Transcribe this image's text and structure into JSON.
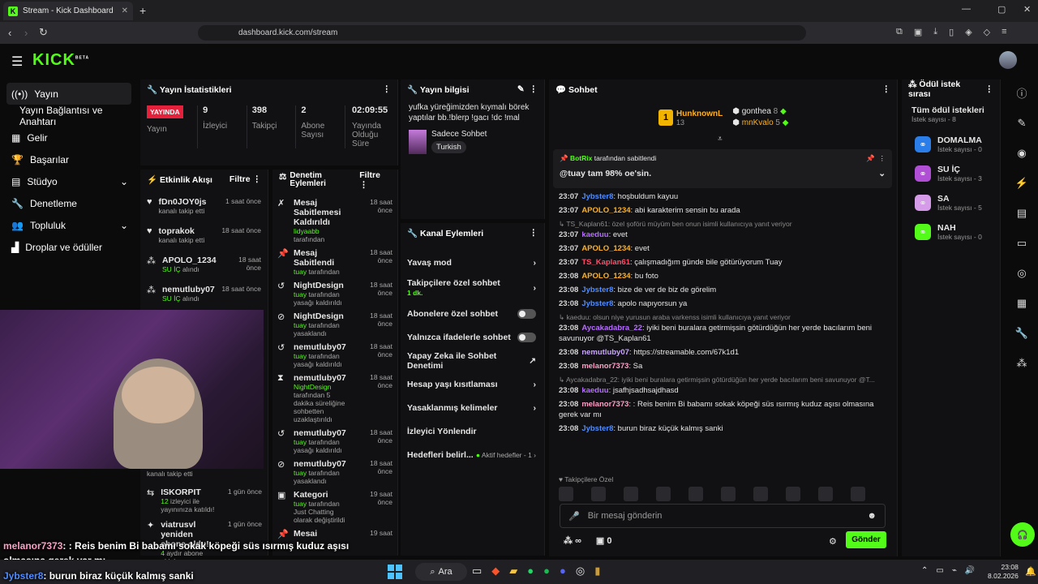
{
  "browser": {
    "tab_title": "Stream - Kick Dashboard",
    "url": "dashboard.kick.com/stream"
  },
  "brand": {
    "logo": "KICK",
    "beta": "BETA",
    "accent": "#53fc18"
  },
  "sidebar": {
    "items": [
      {
        "label": "Yayın",
        "icon": "broadcast-icon"
      },
      {
        "label": "Yayın Bağlantısı ve Anahtarı",
        "icon": ""
      },
      {
        "label": "Gelir",
        "icon": "revenue-icon"
      },
      {
        "label": "Başarılar",
        "icon": "trophy-icon"
      },
      {
        "label": "Stüdyo",
        "icon": "studio-icon"
      },
      {
        "label": "Denetleme",
        "icon": "wrench-icon"
      },
      {
        "label": "Topluluk",
        "icon": "community-icon"
      },
      {
        "label": "Droplar ve ödüller",
        "icon": "drops-icon"
      }
    ]
  },
  "stats": {
    "title": "Yayın İstatistikleri",
    "live_badge": "YAYINDA",
    "live_label": "Yayın",
    "viewers": "9",
    "viewers_label": "İzleyici",
    "followers": "398",
    "followers_label": "Takipçi",
    "subs": "2",
    "subs_label": "Abone Sayısı",
    "uptime": "02:09:55",
    "uptime_label": "Yayında Olduğu Süre"
  },
  "streaminfo": {
    "title": "Yayın bilgisi",
    "stream_title": "yufka yüreğimizden kıymalı börek yaptılar bb.!blerp !gacı !dc !mal",
    "category": "Sadece Sohbet",
    "language": "Turkish"
  },
  "activity": {
    "title": "Etkinlik Akışı",
    "filter": "Filtre",
    "items": [
      {
        "name": "fDn0JOY0js",
        "sub": "kanalı takip etti",
        "when": "1 saat önce"
      },
      {
        "name": "toprakok",
        "sub": "kanalı takip etti",
        "when": "18 saat önce"
      },
      {
        "name": "APOLO_1234",
        "sub_hl": "SU İÇ",
        "sub": " alındı",
        "when": "18 saat önce"
      },
      {
        "name": "nemutluby07",
        "sub_hl": "SU İÇ",
        "sub": " alındı",
        "when": "18 saat önce"
      }
    ],
    "lower": [
      {
        "name": "",
        "sub": "kanalı takip etti",
        "when": ""
      },
      {
        "name": "ISKORPIT",
        "sub_hl": "12",
        "sub": " izleyici ile yayınınıza katıldı!",
        "when": "1 gün önce"
      },
      {
        "name": "viatrusvl yeniden abone oldu!",
        "sub_hl": "4",
        "sub": " aydır abone oldular",
        "when": "1 gün önce"
      }
    ]
  },
  "modlog": {
    "title": "Denetim Eylemleri",
    "filter": "Filtre",
    "items": [
      {
        "name": "Mesaj Sabitlemesi Kaldırıldı",
        "by": "lidyaabb",
        "sub": " tarafından",
        "when": "18 saat önce"
      },
      {
        "name": "Mesaj Sabitlendi",
        "by": "tuay",
        "sub": " tarafından",
        "when": "18 saat önce"
      },
      {
        "name": "NightDesign",
        "by": "tuay",
        "sub": " tarafından yasağı kaldırıldı",
        "when": "18 saat önce"
      },
      {
        "name": "NightDesign",
        "by": "tuay",
        "sub": " tarafından yasaklandı",
        "when": "18 saat önce"
      },
      {
        "name": "nemutluby07",
        "by": "tuay",
        "sub": " tarafından yasağı kaldırıldı",
        "when": "18 saat önce"
      },
      {
        "name": "nemutluby07",
        "by": "NightDesign",
        "sub": " tarafından 5 dakika süreliğine sohbetten uzaklaştırıldı",
        "when": "18 saat önce"
      },
      {
        "name": "nemutluby07",
        "by": "tuay",
        "sub": " tarafından yasağı kaldırıldı",
        "when": "18 saat önce"
      },
      {
        "name": "nemutluby07",
        "by": "tuay",
        "sub": " tarafından yasaklandı",
        "when": "18 saat önce"
      },
      {
        "name": "Kategori",
        "by": "tuay",
        "sub": " tarafından Just Chatting olarak değiştirildi",
        "when": "19 saat önce"
      },
      {
        "name": "Mesai",
        "by": "",
        "sub": "",
        "when": "19 saat"
      }
    ]
  },
  "channel_actions": {
    "title": "Kanal Eylemleri",
    "items": [
      {
        "label": "Yavaş mod",
        "kind": "chevron"
      },
      {
        "label": "Takipçilere özel sohbet",
        "extra": "1 dk.",
        "kind": "chevron"
      },
      {
        "label": "Abonelere özel sohbet",
        "kind": "toggle"
      },
      {
        "label": "Yalnızca ifadelerle sohbet",
        "kind": "toggle"
      },
      {
        "label": "Yapay Zeka ile Sohbet Denetimi",
        "kind": "external"
      },
      {
        "label": "Hesap yaşı kısıtlaması",
        "kind": "chevron"
      },
      {
        "label": "Yasaklanmış kelimeler",
        "kind": "chevron"
      },
      {
        "label": "İzleyici Yönlendir",
        "kind": "none"
      },
      {
        "label": "Hedefleri belirl...",
        "extra": "Aktif hedefler - 1",
        "kind": "chevron"
      }
    ]
  },
  "chat": {
    "title": "Sohbet",
    "leaders": [
      {
        "name": "HunknownL",
        "count": "13"
      },
      {
        "name": "gonthea",
        "count": "8"
      },
      {
        "name": "mnKvalo",
        "count": "5"
      }
    ],
    "pinned_by": "BotRix",
    "pinned_suffix": "tarafından sabitlendi",
    "pinned_msg": "@tuay tam 98% oe'sin.",
    "messages": [
      {
        "time": "23:07",
        "user": "Jybster8",
        "color": "#4f8cff",
        "text": ": hoşbuldum kayuu"
      },
      {
        "time": "23:07",
        "user": "APOLO_1234",
        "color": "#ffb020",
        "text": ": abi karakterim sensin bu arada"
      },
      {
        "reply": "TS_Kaplan61: özel şoförü müyüm ben onun isimli kullanıcıya yanıt veriyor",
        "time": "23:07",
        "user": "kaeduu",
        "color": "#b66dff",
        "text": ": evet"
      },
      {
        "time": "23:07",
        "user": "APOLO_1234",
        "color": "#ffb020",
        "text": ": evet"
      },
      {
        "time": "23:07",
        "user": "TS_Kaplan61",
        "color": "#ff4d6a",
        "text": ": çalışmadığım günde bile götürüyorum Tuay"
      },
      {
        "time": "23:08",
        "user": "APOLO_1234",
        "color": "#ffb020",
        "text": ": bu foto"
      },
      {
        "time": "23:08",
        "user": "Jybster8",
        "color": "#4f8cff",
        "text": ": bize de ver de biz de görelim"
      },
      {
        "time": "23:08",
        "user": "Jybster8",
        "color": "#4f8cff",
        "text": ": apolo napıyorsun ya"
      },
      {
        "reply": "kaeduu: olsun niye yurusun araba varkenss isimli kullanıcıya yanıt veriyor",
        "time": "23:08",
        "user": "Aycakadabra_22",
        "color": "#b66dff",
        "text": ": iyiki beni buralara getirmişsin götürdüğün her yerde bacılarım beni savunuyor @TS_Kaplan61"
      },
      {
        "time": "23:08",
        "user": "nemutluby07",
        "color": "#c9a7ff",
        "text": ": https://streamable.com/67k1d1"
      },
      {
        "time": "23:08",
        "user": "melanor7373",
        "color": "#ff9ec7",
        "text": ": Sa"
      },
      {
        "reply": "Aycakadabra_22: iyiki beni buralara getirmişsin götürdüğün her yerde bacılarım beni savunuyor @T...",
        "time": "23:08",
        "user": "kaeduu",
        "color": "#b66dff",
        "text": ": jsafhjsadhsajdhasd"
      },
      {
        "time": "23:08",
        "user": "melanor7373",
        "color": "#ff9ec7",
        "text": ": : Reis benim Bi babamı sokak köpeği süs ısırmış kuduz aşısı olmasına gerek var mı"
      },
      {
        "time": "23:08",
        "user": "Jybster8",
        "color": "#4f8cff",
        "text": ": burun biraz küçük kalmış sanki"
      }
    ],
    "followers_only": "Takipçilere Özel",
    "input_placeholder": "Bir mesaj gönderin",
    "points": "∞",
    "gifts": "0",
    "send": "Gönder"
  },
  "rewards": {
    "title": "Ödül istek sırası",
    "all": "Tüm ödül istekleri",
    "all_count": "İstek sayısı - 8",
    "items": [
      {
        "name": "DOMALMA",
        "count": "İstek sayısı - 0",
        "color": "#2b7de9"
      },
      {
        "name": "SU İÇ",
        "count": "İstek sayısı - 3",
        "color": "#b04fd6"
      },
      {
        "name": "SA",
        "count": "İstek sayısı - 5",
        "color": "#d59ae8"
      },
      {
        "name": "NAH",
        "count": "İstek sayısı - 0",
        "color": "#53fc18"
      }
    ]
  },
  "overlay": {
    "line1_user": "melanor7373",
    "line1_text": ": : Reis benim Bi babamı sokak köpeği süs ısırmış kuduz aşısı",
    "line2_text": "olmasına gerek var mı",
    "line3_user": "Jybster8",
    "line3_text": ": burun biraz küçük kalmış sanki"
  },
  "taskbar": {
    "search": "Ara",
    "time": "23:08",
    "date": "8.02.2026"
  }
}
